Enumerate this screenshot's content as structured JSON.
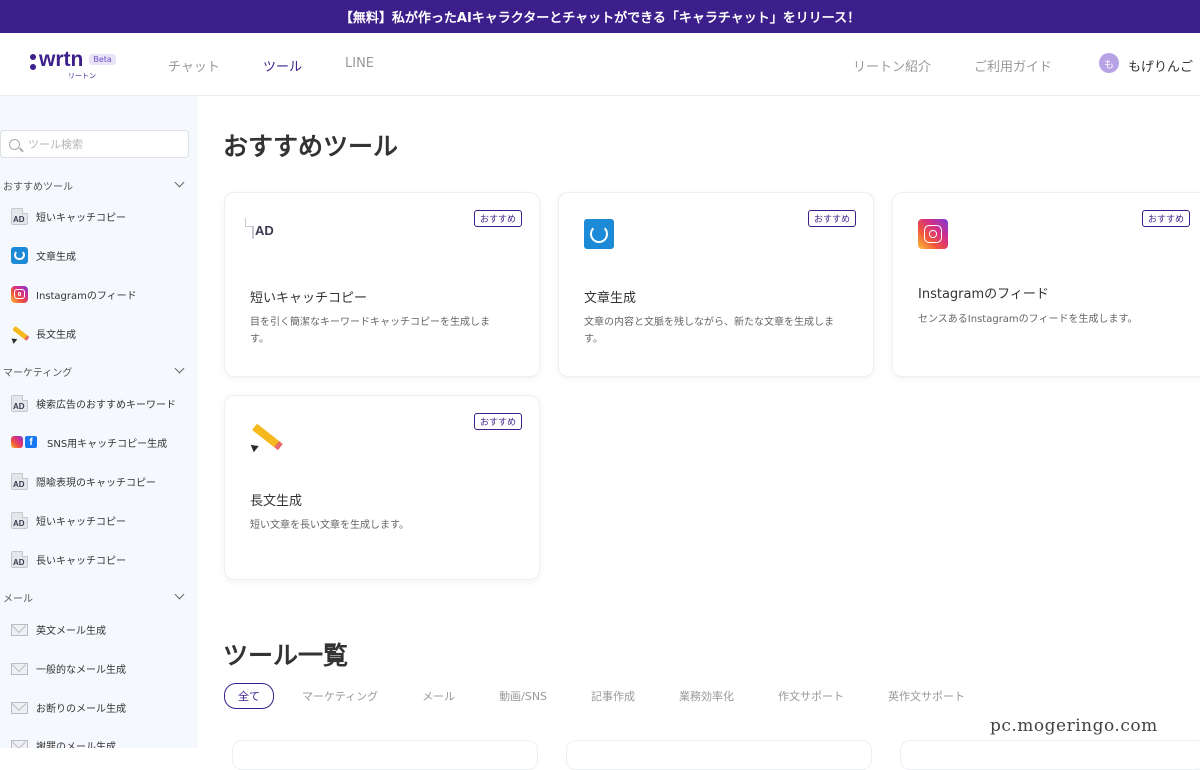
{
  "banner": {
    "text": "【無料】私が作ったAIキャラクターとチャットができる「キャラチャット」をリリース！"
  },
  "header": {
    "logo": "wrtn",
    "logo_sub": "リートン",
    "beta": "Beta",
    "nav": [
      "チャット",
      "ツール",
      "LINE"
    ],
    "active_nav": "ツール",
    "right_links": [
      "リートン紹介",
      "ご利用ガイド"
    ],
    "user": {
      "avatar": "も",
      "name": "もげりんご"
    }
  },
  "sidebar": {
    "search_placeholder": "ツール検索",
    "sections": [
      {
        "title": "おすすめツール",
        "items": [
          {
            "label": "短いキャッチコピー",
            "icon": "ad-icon"
          },
          {
            "label": "文章生成",
            "icon": "sync-icon"
          },
          {
            "label": "Instagramのフィード",
            "icon": "instagram-icon"
          },
          {
            "label": "長文生成",
            "icon": "pencil-icon"
          }
        ]
      },
      {
        "title": "マーケティング",
        "items": [
          {
            "label": "検索広告のおすすめキーワード",
            "icon": "ad-icon"
          },
          {
            "label": "SNS用キャッチコピー生成",
            "icon": "sns-icon"
          },
          {
            "label": "隠喩表現のキャッチコピー",
            "icon": "ad-icon"
          },
          {
            "label": "短いキャッチコピー",
            "icon": "ad-icon"
          },
          {
            "label": "長いキャッチコピー",
            "icon": "ad-icon"
          }
        ]
      },
      {
        "title": "メール",
        "items": [
          {
            "label": "英文メール生成",
            "icon": "mail-icon"
          },
          {
            "label": "一般的なメール生成",
            "icon": "mail-icon"
          },
          {
            "label": "お断りのメール生成",
            "icon": "mail-icon"
          },
          {
            "label": "謝罪のメール生成",
            "icon": "mail-icon"
          }
        ]
      }
    ]
  },
  "main": {
    "recommended_title": "おすすめツール",
    "badge": "おすすめ",
    "cards": [
      {
        "title": "短いキャッチコピー",
        "desc": "目を引く簡潔なキーワードキャッチコピーを生成しま す。",
        "icon": "ad-icon"
      },
      {
        "title": "文章生成",
        "desc": "文章の内容と文脈を残しながら、新たな文章を生成しま す。",
        "icon": "sync-icon"
      },
      {
        "title": "Instagramのフィード",
        "desc": "センスあるInstagramのフィードを生成します。",
        "icon": "instagram-icon"
      },
      {
        "title": "長文生成",
        "desc": "短い文章を長い文章を生成します。",
        "icon": "pencil-icon"
      }
    ],
    "list_title": "ツール一覧",
    "filters": [
      "全て",
      "マーケティング",
      "メール",
      "動画/SNS",
      "記事作成",
      "業務効率化",
      "作文サポート",
      "英作文サポート"
    ],
    "active_filter": "全て"
  },
  "watermark": "pc.mogeringo.com"
}
